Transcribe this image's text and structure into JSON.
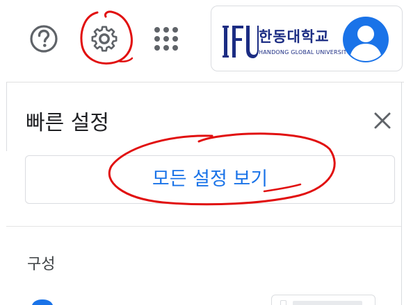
{
  "header": {
    "help_icon": "help-circle-icon",
    "settings_icon": "gear-icon",
    "apps_icon": "apps-grid-icon",
    "account": {
      "org_name": "한동대학교",
      "org_subtitle": "HANDONG GLOBAL UNIVERSITY",
      "logo_icon": "handong-logo",
      "avatar_icon": "default-avatar-icon"
    }
  },
  "quick_settings": {
    "title": "빠른 설정",
    "close_icon": "close-icon",
    "see_all_label": "모든 설정 보기",
    "section_label": "구성"
  },
  "colors": {
    "accent": "#1a73e8",
    "icon_gray": "#5f6368",
    "avatar_blue": "#1a73e8",
    "annotation_red": "#e10f0f",
    "brand_navy": "#1b2c83"
  }
}
